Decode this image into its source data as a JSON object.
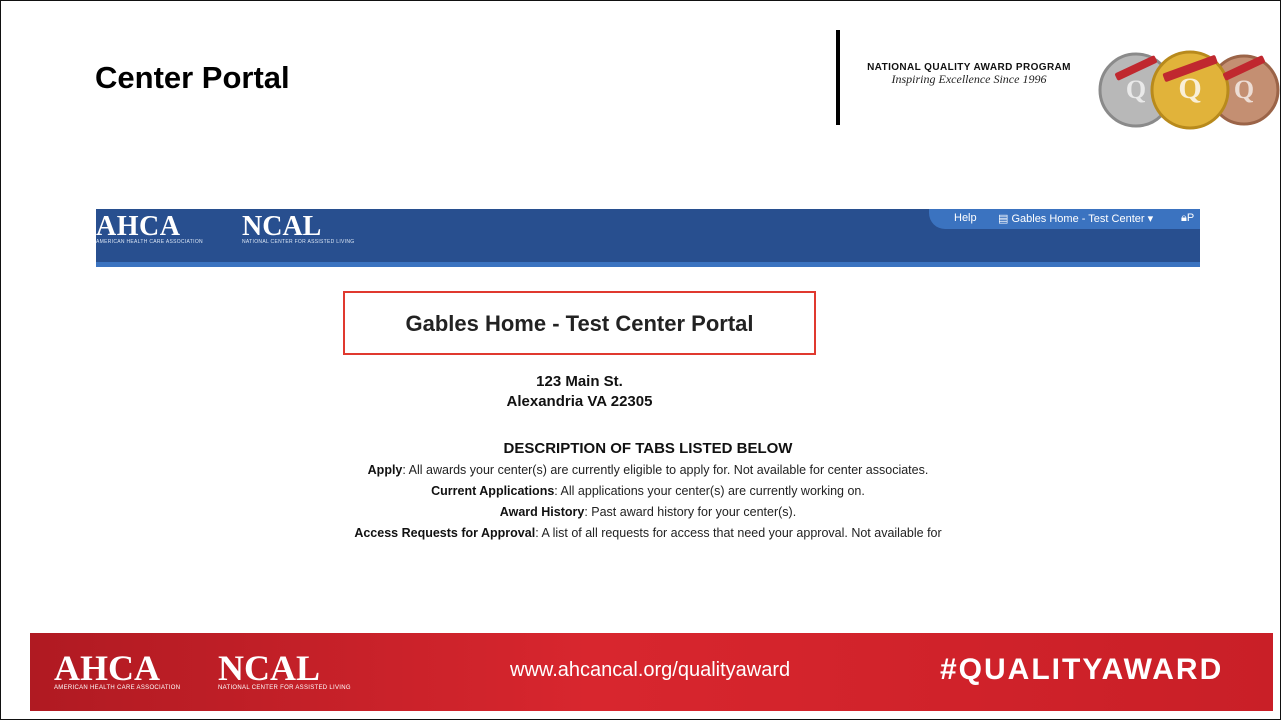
{
  "slide": {
    "title": "Center Portal",
    "program_name": "NATIONAL QUALITY AWARD PROGRAM",
    "program_tagline": "Inspiring Excellence Since 1996",
    "medal_labels": [
      "NATIONAL QUALITY AWARD",
      "NATIONAL QUALITY AWARD",
      "NATIONAL QUALITY AWARD"
    ]
  },
  "portal_nav": {
    "ahca_logo": "AHCA",
    "ahca_sub": "AMERICAN HEALTH CARE ASSOCIATION",
    "ncal_logo": "NCAL",
    "ncal_sub": "NATIONAL CENTER FOR ASSISTED LIVING",
    "help_label": "Help",
    "center_selector": "Gables Home - Test Center",
    "profile_partial": "P",
    "colors": {
      "nav_bg": "#284f8f",
      "pill_bg": "#3b73c0"
    }
  },
  "portal": {
    "title": "Gables Home - Test Center Portal",
    "address_line1": "123 Main St.",
    "address_line2": "Alexandria VA 22305",
    "description_heading": "DESCRIPTION OF TABS LISTED BELOW",
    "tabs_description": [
      {
        "term": "Apply",
        "text": ": All awards your center(s) are currently eligible to apply for. Not available for center associates."
      },
      {
        "term": "Current Applications",
        "text": ": All applications your center(s) are currently working on."
      },
      {
        "term": "Award History",
        "text": ": Past award history for your center(s)."
      },
      {
        "term": "Access Requests for Approval",
        "text": ": A list of all requests for access that need your approval. Not available for"
      }
    ],
    "highlight_color": "#e0392f"
  },
  "footer": {
    "ahca_logo": "AHCA",
    "ahca_sub": "AMERICAN HEALTH CARE ASSOCIATION",
    "ncal_logo": "NCAL",
    "ncal_sub": "NATIONAL CENTER FOR ASSISTED LIVING",
    "url": "www.ahcancal.org/qualityaward",
    "hashtag": "#QUALITYAWARD",
    "colors": {
      "bg": "#c91f27"
    }
  }
}
